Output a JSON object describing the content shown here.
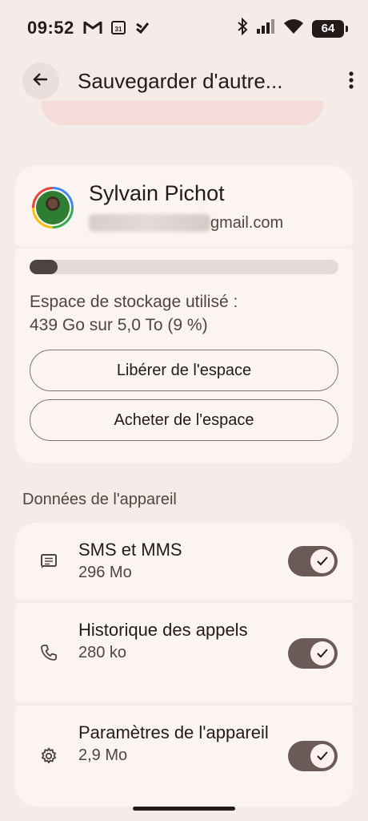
{
  "status_bar": {
    "time": "09:52",
    "battery": "64",
    "left_icons": [
      "gmail-icon",
      "calendar-icon",
      "tasks-icon"
    ],
    "right_icons": [
      "bluetooth-icon",
      "signal-icon",
      "wifi-icon",
      "battery-icon"
    ]
  },
  "top_bar": {
    "title": "Sauvegarder d'autre...",
    "back_icon": "arrow-back-icon",
    "more_icon": "more-vert-icon"
  },
  "account": {
    "name": "Sylvain Pichot",
    "email_visible": "gmail.com"
  },
  "storage": {
    "used_fraction": 0.09,
    "label": "Espace de stockage utilisé :",
    "value": "439 Go sur 5,0 To (9 %)",
    "free_button": "Libérer de l'espace",
    "buy_button": "Acheter de l'espace"
  },
  "device_data": {
    "section_title": "Données de l'appareil",
    "items": [
      {
        "title": "SMS et MMS",
        "size": "296 Mo",
        "icon": "message-icon",
        "enabled": true
      },
      {
        "title": "Historique des appels",
        "size": "280 ko",
        "icon": "phone-icon",
        "enabled": true
      },
      {
        "title": "Paramètres de l'appareil",
        "size": "2,9 Mo",
        "icon": "settings-gear-icon",
        "enabled": true
      }
    ]
  },
  "colors": {
    "background": "#f5ebe9",
    "card": "#fcf4f2",
    "toggle_on": "#6b5a57",
    "progress_fill": "#4e4341"
  }
}
